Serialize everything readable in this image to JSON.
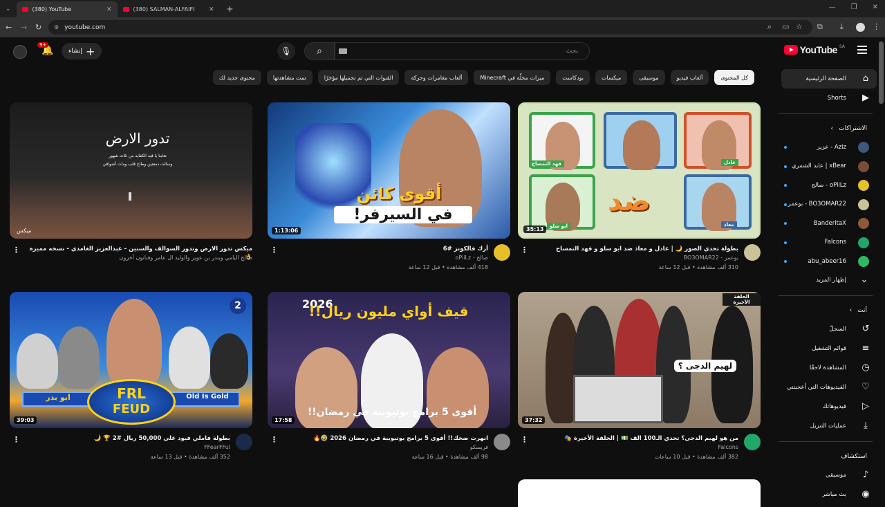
{
  "browser": {
    "tabs": [
      {
        "title": "(380) YouTube",
        "active": true
      },
      {
        "title": "(380) SALMAN-ALFAIFI",
        "active": false
      }
    ],
    "url": "youtube.com"
  },
  "header": {
    "logo_text": "YouTube",
    "country_code": "SA",
    "search_placeholder": "بحث",
    "create_label": "إنشاء",
    "notification_count": "9+"
  },
  "chips": [
    {
      "label": "كل المحتوى",
      "active": true
    },
    {
      "label": "ألعاب فيديو"
    },
    {
      "label": "موسيقى"
    },
    {
      "label": "ميكسات"
    },
    {
      "label": "بودكاست"
    },
    {
      "label": "ميزات مخلّة في Minecraft"
    },
    {
      "label": "ألعاب مغامرات وحركة"
    },
    {
      "label": "القنوات التي تم تحميلها مؤخرًا"
    },
    {
      "label": "تمت مشاهدتها"
    },
    {
      "label": "محتوى جديد لك"
    }
  ],
  "sidebar": {
    "main": [
      {
        "label": "الصفحة الرئيسية",
        "icon": "home-icon"
      },
      {
        "label": "Shorts",
        "icon": "shorts-icon"
      }
    ],
    "subscriptions_title": "الاشتراكات",
    "subscriptions": [
      {
        "name": "Aziz - عزيز",
        "color": "#3b5a7a"
      },
      {
        "name": "xBear | عابد الشمري",
        "color": "#7a4b3b"
      },
      {
        "name": "oPiiLz - صالح",
        "color": "#e5c02a"
      },
      {
        "name": "BO3OMAR22 - بوعمر",
        "color": "#c9c39a"
      },
      {
        "name": "BanderitaX",
        "color": "#8a5a3a"
      },
      {
        "name": "Falcons",
        "color": "#1fa86a"
      },
      {
        "name": "abu_abeer16",
        "color": "#2fb862"
      }
    ],
    "show_more": "إظهار المزيد",
    "you_title": "أنت",
    "you_items": [
      {
        "label": "السجلّ",
        "icon": "history-icon"
      },
      {
        "label": "قوائم التشغيل",
        "icon": "playlists-icon"
      },
      {
        "label": "المشاهدة لاحقًا",
        "icon": "watch-later-icon"
      },
      {
        "label": "الفيديوهات التي أعجبتني",
        "icon": "like-icon"
      },
      {
        "label": "فيديوهاتك",
        "icon": "your-videos-icon"
      },
      {
        "label": "عمليات التنزيل",
        "icon": "download-icon"
      }
    ],
    "explore_title": "استكشاف",
    "explore_items": [
      {
        "label": "موسيقى",
        "icon": "music-icon"
      },
      {
        "label": "بث مباشر",
        "icon": "live-icon"
      }
    ]
  },
  "videos": [
    {
      "title": "بطولة تحدي الصور 🌙 | عادل و معاذ ضد ابو سلو و فهد التمساح",
      "channel": "بوعمر - BO3OMAR22",
      "stats": "310 ألف مشاهدة • قبل 12 ساعة",
      "duration": "35:13",
      "avatar_color": "#c9c39a"
    },
    {
      "title": "أرك فالكونز #6",
      "channel": "صالح - oPiiLz",
      "stats": "418 ألف مشاهدة • قبل 12 ساعة",
      "duration": "1:13:06",
      "avatar_color": "#e5c02a"
    },
    {
      "title": "ميكس تدور الارض وتدور السوالف والسنين - عبدالعزيز الغامدي - نسخه مميزه 👌",
      "channel": "صالح اليامي وبندر بن عوير والوليد ال عامر وفنانون آخرون",
      "stats": "",
      "duration": "ميكس",
      "avatar_color": ""
    },
    {
      "title": "من هو لهيم الدجى؟ تحدي الـ100 الف 💵 | الحلقة الأخيرة 🎭",
      "channel": "Falcons",
      "stats": "382 ألف مشاهدة • قبل 10 ساعات",
      "duration": "37:32",
      "avatar_color": "#1fa86a"
    },
    {
      "title": "انهرت ضحك!! أقوى 5 برامج يوتيوبية في رمضان 2026 🤣🔥",
      "channel": "فريسكو",
      "stats": "98 ألف مشاهدة • قبل 16 ساعة",
      "duration": "17:58",
      "avatar_color": "#8a8a8a"
    },
    {
      "title": "بطولة فاملي فيود على 50,000 ريال #2 🏆 🌙",
      "channel": "FFearFFul",
      "stats": "352 ألف مشاهدة • قبل 13 ساعة",
      "duration": "39:03",
      "avatar_color": "#1b2a4a"
    }
  ],
  "thumb_text": {
    "v1_big": "ضد",
    "v1_tags": [
      "عادل",
      "فهد التمساح",
      "معاذ",
      "ابو سلو"
    ],
    "v2_line1": "أقوى كائن",
    "v2_line2": "في السيرفر!",
    "v3_title": "تدور الارض",
    "v3_sub1": "تعابنا يا قيه الكفايه من ثلاث شهور",
    "v3_sub2": "وسالت دمعتين وطاح قلب ومات أشواقي",
    "v4_badge": "الحلقة الأخيرة",
    "v4_q": "لهيم الدجى ؟",
    "v5_year": "2026",
    "v5_line1": "قيف أواي مليون ريال!!",
    "v5_line2": "أقوى 5 برامج يوتيوبية في رمضان!!",
    "v6_num": "2",
    "v6_frl": "FRL",
    "v6_feud": "FEUD",
    "v6_left": "ابو بدر",
    "v6_right": "Old Is Gold"
  }
}
